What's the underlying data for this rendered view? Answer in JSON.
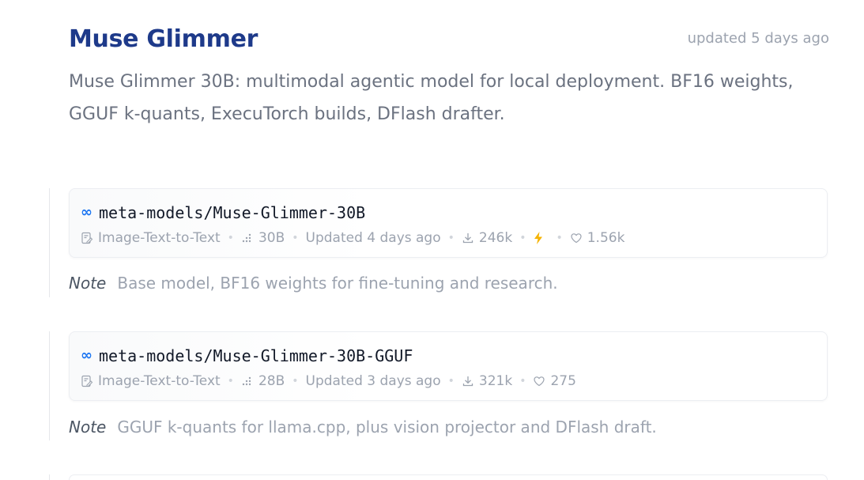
{
  "collection": {
    "title": "Muse Glimmer",
    "updated": "updated 5 days ago",
    "description": "Muse Glimmer 30B: multimodal agentic model for local deployment. BF16 weights, GGUF k-quants, ExecuTorch builds, DFlash drafter."
  },
  "items": [
    {
      "repo": "meta-models/Muse-Glimmer-30B",
      "pipeline": "Image-Text-to-Text",
      "params": "30B",
      "updated": "Updated 4 days ago",
      "downloads": "246k",
      "likes": "1.56k",
      "note_label": "Note",
      "note_text": "Base model, BF16 weights for fine-tuning and research."
    },
    {
      "repo": "meta-models/Muse-Glimmer-30B-GGUF",
      "pipeline": "Image-Text-to-Text",
      "params": "28B",
      "updated": "Updated 3 days ago",
      "downloads": "321k",
      "likes": "275",
      "note_label": "Note",
      "note_text": "GGUF k-quants for llama.cpp, plus vision projector and DFlash draft."
    }
  ],
  "icons": {
    "org_logo": "meta-infinity-icon",
    "pipeline": "image-text-icon",
    "params": "parameters-icon",
    "downloads": "download-icon",
    "inference": "lightning-icon",
    "likes": "heart-icon"
  },
  "colors": {
    "title": "#1e3a8a",
    "meta_logo": "#1d76f2",
    "lightning": "#f5b301"
  }
}
